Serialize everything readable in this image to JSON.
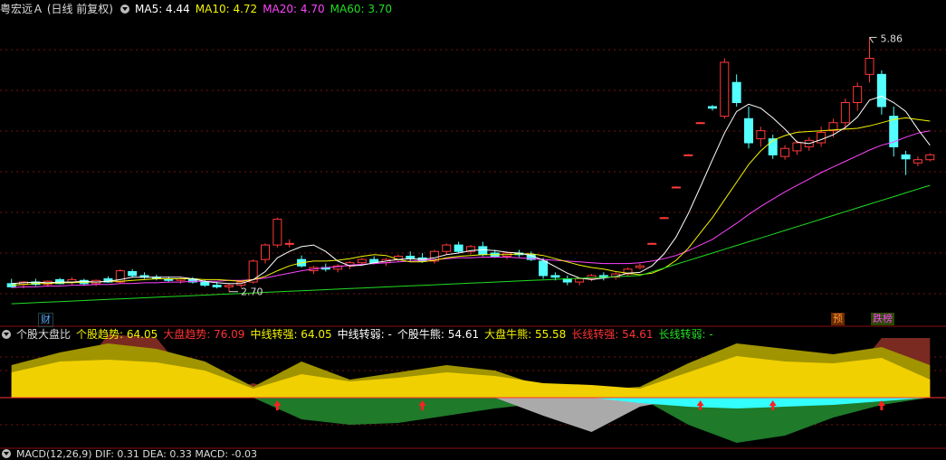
{
  "header": {
    "title": "粤宏远Ａ (日线 前复权)",
    "ma": [
      {
        "label": "MA5: 4.44",
        "color": "#ffffff"
      },
      {
        "label": "MA10: 4.72",
        "color": "#f4f400"
      },
      {
        "label": "MA20: 4.70",
        "color": "#ff44ff"
      },
      {
        "label": "MA60: 3.70",
        "color": "#22dd22"
      }
    ]
  },
  "indicator_header": {
    "name": "个股大盘比",
    "items": [
      {
        "label": "个股趋势: 64.05",
        "color": "#f4f400"
      },
      {
        "label": "大盘趋势: 76.09",
        "color": "#ff3333"
      },
      {
        "label": "中线转强: 64.05",
        "color": "#f4f400"
      },
      {
        "label": "中线转弱: -",
        "color": "#ffffff"
      },
      {
        "label": "个股牛熊: 54.61",
        "color": "#ffffff"
      },
      {
        "label": "大盘牛熊: 55.58",
        "color": "#f4f400"
      },
      {
        "label": "长线转强: 54.61",
        "color": "#ff3333"
      },
      {
        "label": "长线转弱: -",
        "color": "#22dd22"
      }
    ]
  },
  "macd_header": {
    "text": "MACD(12,26,9)  DIF: 0.31  DEA: 0.33  MACD: -0.03"
  },
  "tags": {
    "cai": {
      "label": "财",
      "color": "#55aaff"
    },
    "yu": {
      "label": "预",
      "color": "#ff9933"
    },
    "die": {
      "label": "跌榜",
      "color": "#ff44ff"
    }
  },
  "chart_data": {
    "type": "candlestick",
    "price_range": [
      2.45,
      6.1
    ],
    "annotations": {
      "high": 5.86,
      "low": 2.7
    },
    "candles": [
      [
        2.8,
        2.86,
        2.75,
        2.76
      ],
      [
        2.79,
        2.83,
        2.74,
        2.82
      ],
      [
        2.82,
        2.86,
        2.77,
        2.79
      ],
      [
        2.79,
        2.84,
        2.76,
        2.83
      ],
      [
        2.85,
        2.87,
        2.79,
        2.8
      ],
      [
        2.82,
        2.88,
        2.79,
        2.85
      ],
      [
        2.84,
        2.86,
        2.78,
        2.8
      ],
      [
        2.8,
        2.85,
        2.77,
        2.84
      ],
      [
        2.86,
        2.89,
        2.81,
        2.82
      ],
      [
        2.82,
        2.98,
        2.8,
        2.96
      ],
      [
        2.95,
        2.98,
        2.88,
        2.9
      ],
      [
        2.9,
        2.94,
        2.86,
        2.88
      ],
      [
        2.88,
        2.91,
        2.84,
        2.86
      ],
      [
        2.86,
        2.89,
        2.82,
        2.84
      ],
      [
        2.84,
        2.88,
        2.8,
        2.86
      ],
      [
        2.86,
        2.88,
        2.8,
        2.82
      ],
      [
        2.82,
        2.85,
        2.76,
        2.78
      ],
      [
        2.78,
        2.82,
        2.74,
        2.76
      ],
      [
        2.76,
        2.8,
        2.7,
        2.78
      ],
      [
        2.78,
        2.84,
        2.75,
        2.82
      ],
      [
        2.82,
        3.1,
        2.8,
        3.08
      ],
      [
        3.1,
        3.3,
        3.05,
        3.28
      ],
      [
        3.28,
        3.62,
        3.25,
        3.6
      ],
      [
        3.3,
        3.35,
        3.25,
        3.3
      ],
      [
        3.1,
        3.15,
        3.0,
        3.02
      ],
      [
        2.96,
        3.02,
        2.92,
        3.0
      ],
      [
        3.0,
        3.05,
        2.95,
        2.98
      ],
      [
        2.98,
        3.04,
        2.94,
        3.02
      ],
      [
        3.02,
        3.08,
        2.98,
        3.06
      ],
      [
        3.06,
        3.12,
        3.03,
        3.1
      ],
      [
        3.1,
        3.14,
        3.04,
        3.06
      ],
      [
        3.06,
        3.12,
        3.02,
        3.1
      ],
      [
        3.1,
        3.16,
        3.07,
        3.14
      ],
      [
        3.14,
        3.2,
        3.08,
        3.12
      ],
      [
        3.12,
        3.18,
        3.06,
        3.08
      ],
      [
        3.08,
        3.22,
        3.05,
        3.2
      ],
      [
        3.2,
        3.3,
        3.16,
        3.28
      ],
      [
        3.28,
        3.32,
        3.18,
        3.2
      ],
      [
        3.2,
        3.28,
        3.16,
        3.26
      ],
      [
        3.26,
        3.32,
        3.14,
        3.16
      ],
      [
        3.18,
        3.22,
        3.12,
        3.14
      ],
      [
        3.14,
        3.2,
        3.1,
        3.18
      ],
      [
        3.18,
        3.22,
        3.13,
        3.16
      ],
      [
        3.16,
        3.2,
        3.08,
        3.1
      ],
      [
        3.08,
        3.12,
        2.86,
        2.9
      ],
      [
        2.9,
        2.94,
        2.84,
        2.88
      ],
      [
        2.86,
        2.9,
        2.78,
        2.82
      ],
      [
        2.82,
        2.88,
        2.78,
        2.86
      ],
      [
        2.86,
        2.92,
        2.83,
        2.9
      ],
      [
        2.9,
        2.94,
        2.84,
        2.88
      ],
      [
        2.88,
        2.94,
        2.85,
        2.92
      ],
      [
        2.92,
        3.0,
        2.89,
        2.98
      ],
      [
        3.0,
        3.05,
        2.98,
        3.02
      ],
      [
        3.3,
        3.31,
        3.29,
        3.3
      ],
      [
        3.62,
        3.63,
        3.61,
        3.62
      ],
      [
        4.0,
        4.01,
        3.99,
        4.0
      ],
      [
        4.4,
        4.41,
        4.39,
        4.4
      ],
      [
        4.8,
        4.81,
        4.79,
        4.8
      ],
      [
        5.0,
        5.02,
        4.95,
        4.98
      ],
      [
        4.88,
        5.6,
        4.85,
        5.55
      ],
      [
        5.3,
        5.4,
        5.0,
        5.05
      ],
      [
        4.85,
        5.0,
        4.48,
        4.55
      ],
      [
        4.6,
        4.75,
        4.5,
        4.7
      ],
      [
        4.6,
        4.65,
        4.35,
        4.4
      ],
      [
        4.38,
        4.52,
        4.34,
        4.48
      ],
      [
        4.45,
        4.58,
        4.4,
        4.55
      ],
      [
        4.5,
        4.62,
        4.45,
        4.58
      ],
      [
        4.55,
        4.75,
        4.5,
        4.68
      ],
      [
        4.7,
        4.85,
        4.62,
        4.8
      ],
      [
        4.8,
        5.1,
        4.72,
        5.05
      ],
      [
        5.05,
        5.3,
        4.95,
        5.25
      ],
      [
        5.4,
        5.86,
        5.3,
        5.6
      ],
      [
        5.4,
        5.45,
        4.9,
        5.0
      ],
      [
        4.88,
        5.0,
        4.38,
        4.5
      ],
      [
        4.4,
        4.45,
        4.15,
        4.35
      ],
      [
        4.3,
        4.38,
        4.26,
        4.34
      ],
      [
        4.34,
        4.42,
        4.32,
        4.4
      ]
    ],
    "ma5": [
      2.8,
      2.81,
      2.82,
      2.81,
      2.82,
      2.82,
      2.83,
      2.82,
      2.83,
      2.85,
      2.88,
      2.88,
      2.88,
      2.88,
      2.88,
      2.86,
      2.83,
      2.81,
      2.8,
      2.8,
      2.85,
      2.95,
      3.12,
      3.2,
      3.26,
      3.28,
      3.2,
      3.08,
      3.02,
      3.03,
      3.06,
      3.08,
      3.1,
      3.11,
      3.1,
      3.12,
      3.16,
      3.18,
      3.21,
      3.22,
      3.21,
      3.19,
      3.18,
      3.15,
      3.09,
      3.01,
      2.93,
      2.87,
      2.85,
      2.87,
      2.89,
      2.93,
      2.94,
      3.02,
      3.17,
      3.38,
      3.67,
      4.0,
      4.34,
      4.67,
      4.94,
      5.03,
      4.98,
      4.86,
      4.72,
      4.56,
      4.54,
      4.59,
      4.65,
      4.74,
      4.87,
      5.08,
      5.13,
      5.05,
      4.94,
      4.72,
      4.52
    ],
    "ma10": [
      2.78,
      2.79,
      2.8,
      2.8,
      2.81,
      2.81,
      2.82,
      2.82,
      2.83,
      2.83,
      2.84,
      2.85,
      2.86,
      2.86,
      2.86,
      2.86,
      2.85,
      2.85,
      2.84,
      2.83,
      2.85,
      2.89,
      2.96,
      3.02,
      3.06,
      3.08,
      3.08,
      3.09,
      3.11,
      3.14,
      3.16,
      3.15,
      3.1,
      3.07,
      3.07,
      3.09,
      3.12,
      3.14,
      3.15,
      3.16,
      3.16,
      3.16,
      3.17,
      3.17,
      3.15,
      3.11,
      3.07,
      3.03,
      3.0,
      2.98,
      2.95,
      2.93,
      2.91,
      2.93,
      2.99,
      3.09,
      3.24,
      3.43,
      3.62,
      3.84,
      4.06,
      4.28,
      4.45,
      4.58,
      4.64,
      4.68,
      4.69,
      4.7,
      4.71,
      4.72,
      4.73,
      4.76,
      4.8,
      4.84,
      4.86,
      4.84,
      4.82
    ],
    "ma20": [
      2.75,
      2.76,
      2.76,
      2.77,
      2.77,
      2.78,
      2.78,
      2.79,
      2.79,
      2.8,
      2.8,
      2.81,
      2.81,
      2.82,
      2.82,
      2.83,
      2.83,
      2.83,
      2.84,
      2.84,
      2.85,
      2.87,
      2.9,
      2.93,
      2.96,
      2.98,
      3.0,
      3.01,
      3.03,
      3.04,
      3.05,
      3.06,
      3.07,
      3.08,
      3.09,
      3.1,
      3.11,
      3.12,
      3.12,
      3.13,
      3.13,
      3.13,
      3.12,
      3.11,
      3.1,
      3.09,
      3.08,
      3.07,
      3.06,
      3.05,
      3.05,
      3.05,
      3.06,
      3.08,
      3.11,
      3.15,
      3.21,
      3.28,
      3.35,
      3.45,
      3.55,
      3.66,
      3.76,
      3.85,
      3.94,
      4.02,
      4.1,
      4.18,
      4.25,
      4.32,
      4.39,
      4.46,
      4.52,
      4.56,
      4.62,
      4.67,
      4.7
    ]
  },
  "indicator": {
    "sample_at": [
      0,
      4,
      8,
      12,
      16,
      20,
      24,
      28,
      32,
      36,
      40,
      44,
      48,
      52,
      56,
      60,
      64,
      68,
      72,
      76
    ],
    "yellow": [
      28,
      40,
      42,
      39,
      30,
      10,
      26,
      18,
      22,
      28,
      24,
      16,
      14,
      10,
      28,
      46,
      40,
      38,
      44,
      20
    ],
    "olive": [
      36,
      50,
      60,
      54,
      40,
      12,
      40,
      20,
      28,
      36,
      30,
      12,
      8,
      12,
      38,
      60,
      54,
      48,
      56,
      36
    ],
    "magenta_top": [
      20,
      24,
      20,
      26,
      18,
      6,
      14,
      12,
      12,
      12,
      14,
      10,
      8,
      6,
      10,
      26,
      24,
      20,
      22,
      14
    ],
    "darkred": [
      0,
      0,
      10,
      12,
      0,
      4,
      0,
      0,
      0,
      0,
      0,
      0,
      0,
      0,
      0,
      0,
      0,
      0,
      10,
      30
    ],
    "green": [
      0,
      0,
      0,
      0,
      0,
      0,
      -24,
      -30,
      -28,
      -20,
      -12,
      -6,
      -10,
      0,
      -30,
      -50,
      -42,
      -22,
      -8,
      0
    ],
    "gray": [
      0,
      0,
      0,
      0,
      0,
      0,
      0,
      0,
      0,
      0,
      0,
      -20,
      -38,
      -10,
      0,
      0,
      0,
      0,
      0,
      0
    ],
    "cyan": [
      0,
      0,
      0,
      0,
      0,
      0,
      0,
      0,
      0,
      0,
      0,
      0,
      0,
      -6,
      -10,
      -12,
      -10,
      -8,
      -4,
      0
    ],
    "arrows_at": [
      22,
      34,
      57,
      63,
      72
    ]
  }
}
